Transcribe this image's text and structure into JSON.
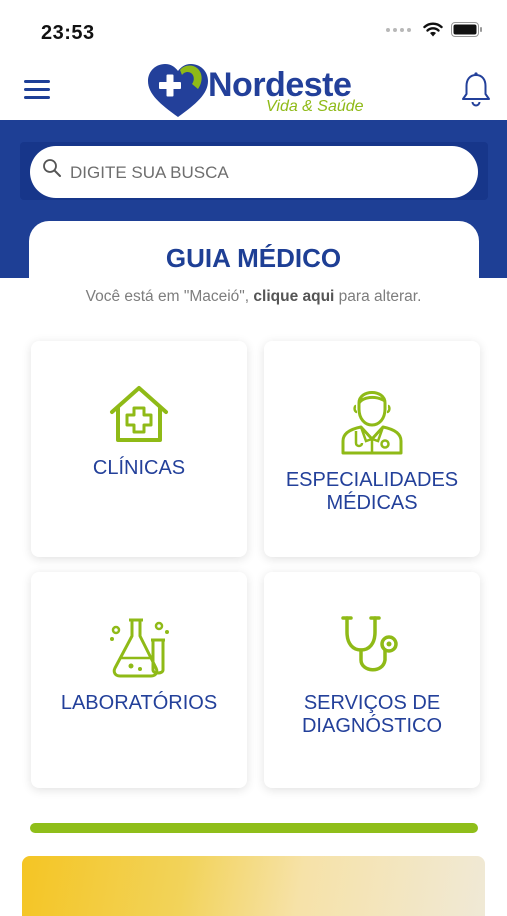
{
  "status_bar": {
    "time": "23:53"
  },
  "header": {
    "logo_name": "Nordeste",
    "logo_tagline": "Vida & Saúde"
  },
  "search": {
    "placeholder": "DIGITE SUA BUSCA",
    "value": ""
  },
  "guide": {
    "title": "GUIA MÉDICO",
    "location_prefix": "Você está em \"Maceió\", ",
    "location_link": "clique aqui",
    "location_suffix": " para alterar."
  },
  "categories": [
    {
      "label": "CLÍNICAS",
      "icon": "clinic-icon"
    },
    {
      "label": "ESPECIALIDADES\nMÉDICAS",
      "icon": "doctor-icon"
    },
    {
      "label": "LABORATÓRIOS",
      "icon": "lab-flask-icon"
    },
    {
      "label": "SERVIÇOS DE\nDIAGNÓSTICO",
      "icon": "stethoscope-icon"
    }
  ],
  "colors": {
    "brand_blue": "#1e3f95",
    "brand_green": "#8fbe1a",
    "icon_green": "#8fba17"
  }
}
